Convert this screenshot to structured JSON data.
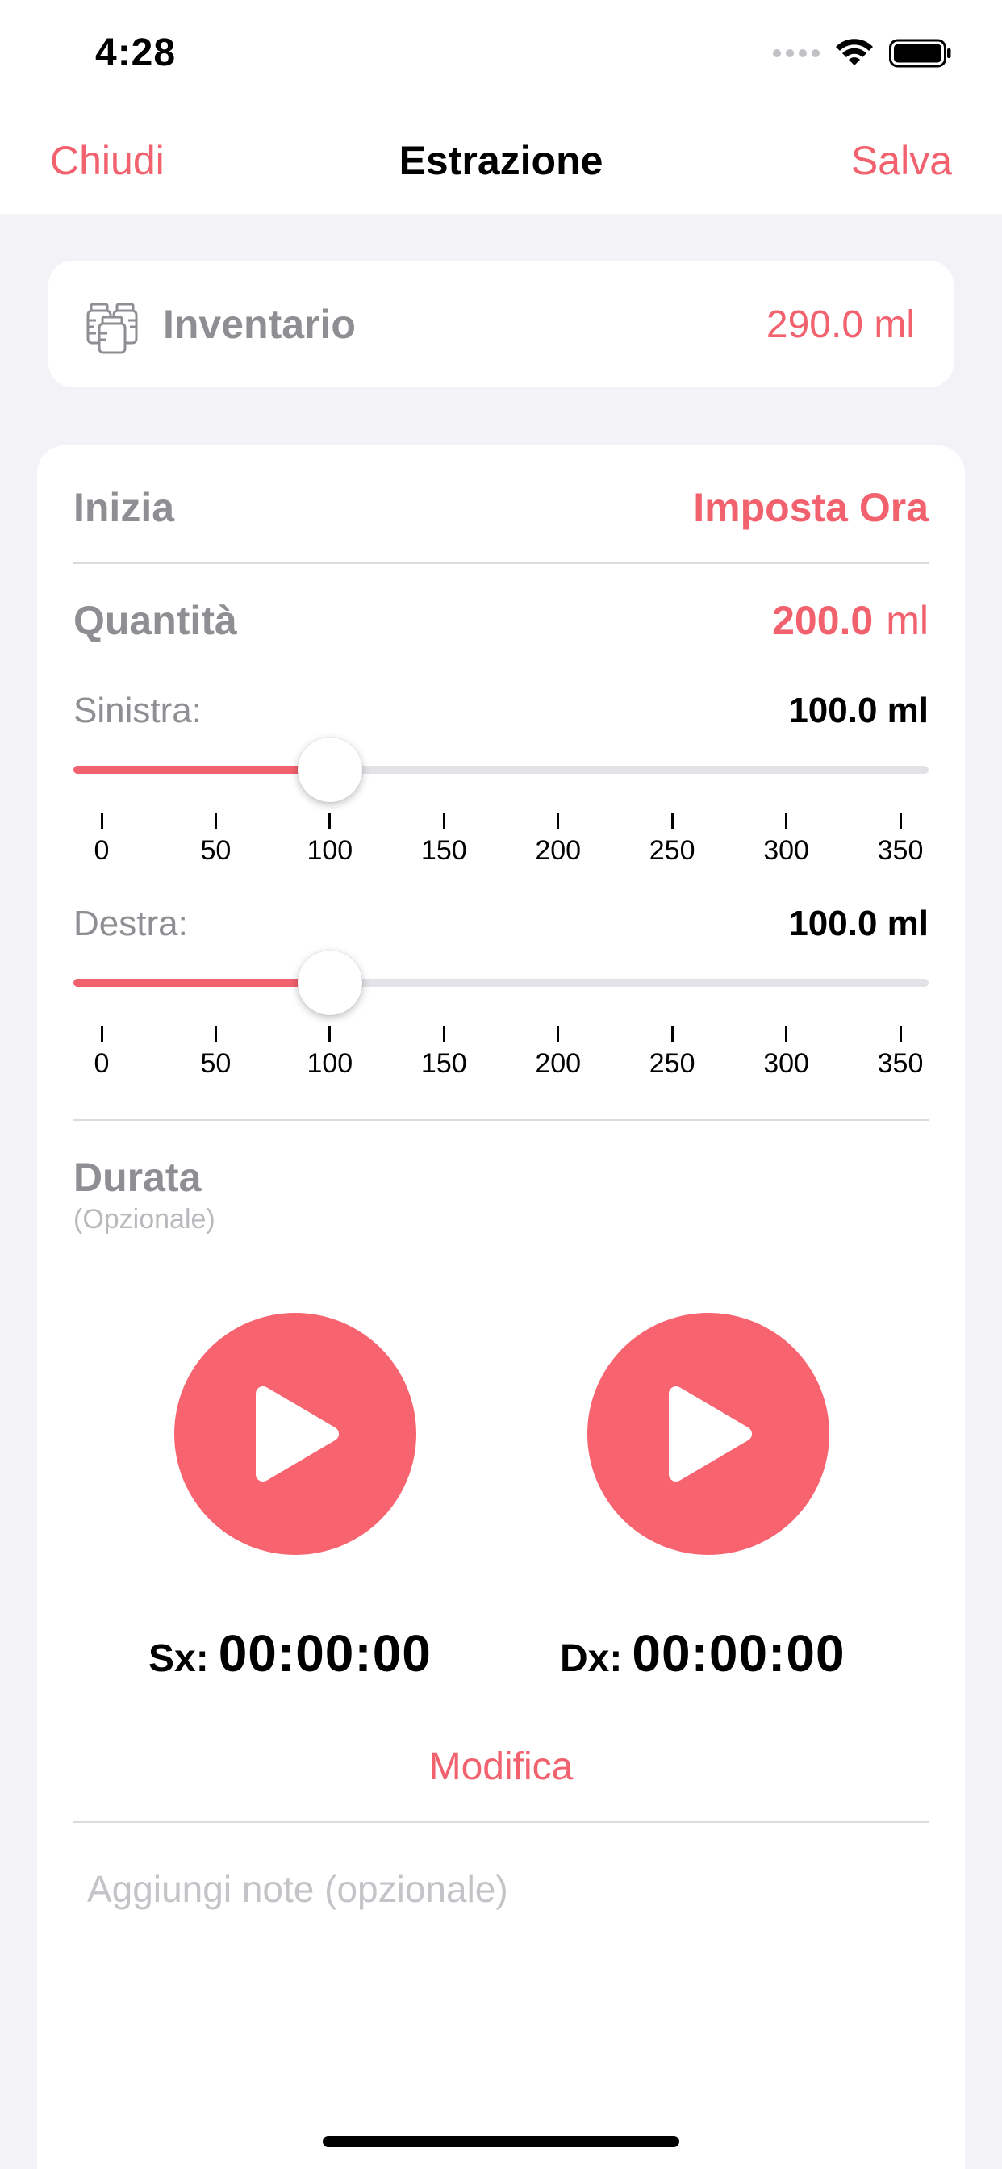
{
  "status_bar": {
    "time": "4:28"
  },
  "nav": {
    "left": "Chiudi",
    "title": "Estrazione",
    "right": "Salva"
  },
  "inventory": {
    "label": "Inventario",
    "value": "290.0 ml"
  },
  "start": {
    "label": "Inizia",
    "action": "Imposta Ora"
  },
  "quantity": {
    "label": "Quantità",
    "value": "200.0",
    "unit": "ml",
    "scale": {
      "min": 0,
      "max": 350,
      "ticks": [
        "0",
        "50",
        "100",
        "150",
        "200",
        "250",
        "300",
        "350"
      ]
    },
    "left": {
      "label": "Sinistra:",
      "value_text": "100.0 ml",
      "value": 100
    },
    "right": {
      "label": "Destra:",
      "value_text": "100.0 ml",
      "value": 100
    }
  },
  "duration": {
    "label": "Durata",
    "sublabel": "(Opzionale)",
    "left_prefix": "Sx:",
    "left_time": "00:00:00",
    "right_prefix": "Dx:",
    "right_time": "00:00:00",
    "edit": "Modifica"
  },
  "notes": {
    "placeholder": "Aggiungi note (opzionale)"
  },
  "colors": {
    "accent": "#f2616e",
    "play": "#f76470",
    "background": "#f2f2f7"
  }
}
